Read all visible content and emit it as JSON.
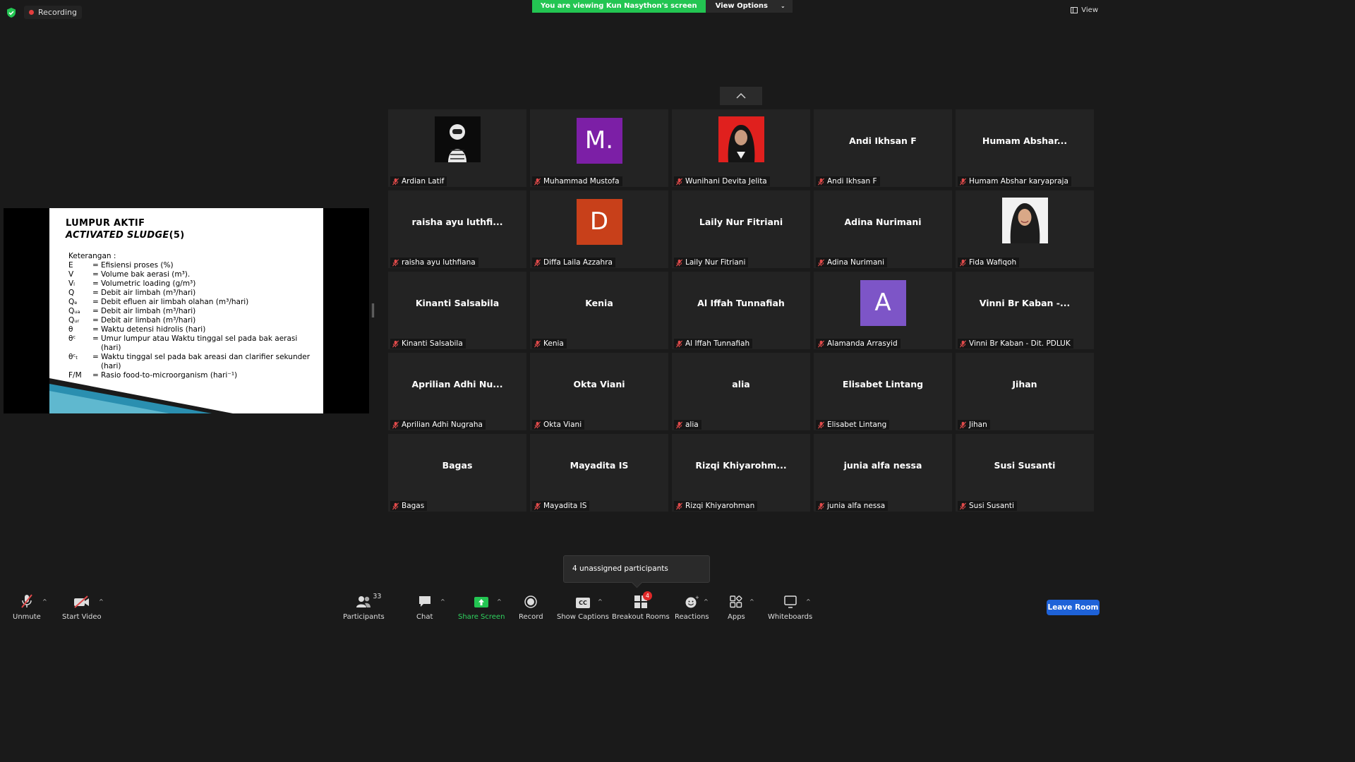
{
  "recording_label": "Recording",
  "viewing_banner": "You are viewing Kun Nasython's screen",
  "view_options_label": "View Options",
  "view_label": "View",
  "slide": {
    "title_line1": "LUMPUR AKTIF",
    "title_line2_italic": "ACTIVATED SLUDGE",
    "title_line2_suffix": "(5)",
    "intro": "Keterangan :",
    "rows": [
      {
        "sym": "E",
        "eq": "=",
        "def": "Efisiensi proses (%)"
      },
      {
        "sym": "V",
        "eq": "=",
        "def": "Volume bak aerasi (m³)."
      },
      {
        "sym": "Vₗ",
        "eq": "=",
        "def": "Volumetric loading (g/m³)"
      },
      {
        "sym": "Q",
        "eq": "=",
        "def": "Debit air limbah (m³/hari)"
      },
      {
        "sym": "Qₑ",
        "eq": "=",
        "def": "Debit efluen air limbah olahan (m³/hari)"
      },
      {
        "sym": "Qᵤₐ",
        "eq": "=",
        "def": "Debit air limbah (m³/hari)"
      },
      {
        "sym": "Qᵤᵣ",
        "eq": "=",
        "def": "Debit air limbah (m³/hari)"
      },
      {
        "sym": "θ",
        "eq": "=",
        "def": "Waktu detensi hidrolis (hari)"
      },
      {
        "sym": "θᶜ",
        "eq": "=",
        "def": "Umur lumpur atau Waktu tinggal sel pada bak aerasi (hari)"
      },
      {
        "sym": "θᶜₜ",
        "eq": "=",
        "def": "Waktu tinggal sel pada bak areasi dan clarifier sekunder (hari)"
      },
      {
        "sym": "F/M",
        "eq": "=",
        "def": "Rasio food-to-microorganism (hari⁻¹)"
      }
    ]
  },
  "participants": [
    {
      "label": "Ardian Latif",
      "big": "",
      "avatar": "photo-astronaut"
    },
    {
      "label": "Muhammad Mustofa",
      "big": "M.",
      "avatar": "letter",
      "color": "#7c1fa6"
    },
    {
      "label": "Wunihani Devita Jelita",
      "big": "",
      "avatar": "photo-red-hijab"
    },
    {
      "label": "Andi Ikhsan F",
      "big": "Andi Ikhsan F",
      "avatar": "none"
    },
    {
      "label": "Humam Abshar karyapraja",
      "big": "Humam  Abshar...",
      "avatar": "none"
    },
    {
      "label": "raisha ayu luthfiana",
      "big": "raisha ayu luthfi...",
      "avatar": "none"
    },
    {
      "label": "Diffa Laila Azzahra",
      "big": "D",
      "avatar": "letter",
      "color": "#c8401a"
    },
    {
      "label": "Laily Nur Fitriani",
      "big": "Laily Nur Fitriani",
      "avatar": "none"
    },
    {
      "label": "Adina Nurimani",
      "big": "Adina Nurimani",
      "avatar": "none"
    },
    {
      "label": "Fida Wafiqoh",
      "big": "",
      "avatar": "photo-hijab"
    },
    {
      "label": "Kinanti Salsabila",
      "big": "Kinanti Salsabila",
      "avatar": "none"
    },
    {
      "label": "Kenia",
      "big": "Kenia",
      "avatar": "none"
    },
    {
      "label": "Al Iffah Tunnafiah",
      "big": "Al Iffah Tunnafiah",
      "avatar": "none"
    },
    {
      "label": "Alamanda Arrasyid",
      "big": "A",
      "avatar": "letter",
      "color": "#7d55c7"
    },
    {
      "label": "Vinni Br Kaban - Dit. PDLUK",
      "big": "Vinni Br Kaban -...",
      "avatar": "none"
    },
    {
      "label": "Aprilian Adhi Nugraha",
      "big": "Aprilian  Adhi  Nu...",
      "avatar": "none"
    },
    {
      "label": "Okta Viani",
      "big": "Okta Viani",
      "avatar": "none"
    },
    {
      "label": "alia",
      "big": "alia",
      "avatar": "none"
    },
    {
      "label": "Elisabet Lintang",
      "big": "Elisabet Lintang",
      "avatar": "none"
    },
    {
      "label": "Jihan",
      "big": "Jihan",
      "avatar": "none"
    },
    {
      "label": "Bagas",
      "big": "Bagas",
      "avatar": "none"
    },
    {
      "label": "Mayadita IS",
      "big": "Mayadita IS",
      "avatar": "none"
    },
    {
      "label": "Rizqi Khiyarohman",
      "big": "Rizqi  Khiyarohm...",
      "avatar": "none"
    },
    {
      "label": "junia alfa nessa",
      "big": "junia alfa nessa",
      "avatar": "none"
    },
    {
      "label": "Susi Susanti",
      "big": "Susi Susanti",
      "avatar": "none"
    }
  ],
  "tooltip": "4 unassigned participants",
  "toolbar": {
    "unmute": "Unmute",
    "start_video": "Start Video",
    "participants": "Participants",
    "participants_count": "33",
    "chat": "Chat",
    "share_screen": "Share Screen",
    "record": "Record",
    "show_captions": "Show Captions",
    "captions_icon_text": "CC",
    "breakout_rooms": "Breakout Rooms",
    "breakout_badge": "4",
    "reactions": "Reactions",
    "apps": "Apps",
    "whiteboards": "Whiteboards",
    "leave_room": "Leave Room"
  },
  "colors": {
    "banner_green": "#23c552",
    "leave_blue": "#1e62d8",
    "mic_off_red": "#e04a4a"
  }
}
